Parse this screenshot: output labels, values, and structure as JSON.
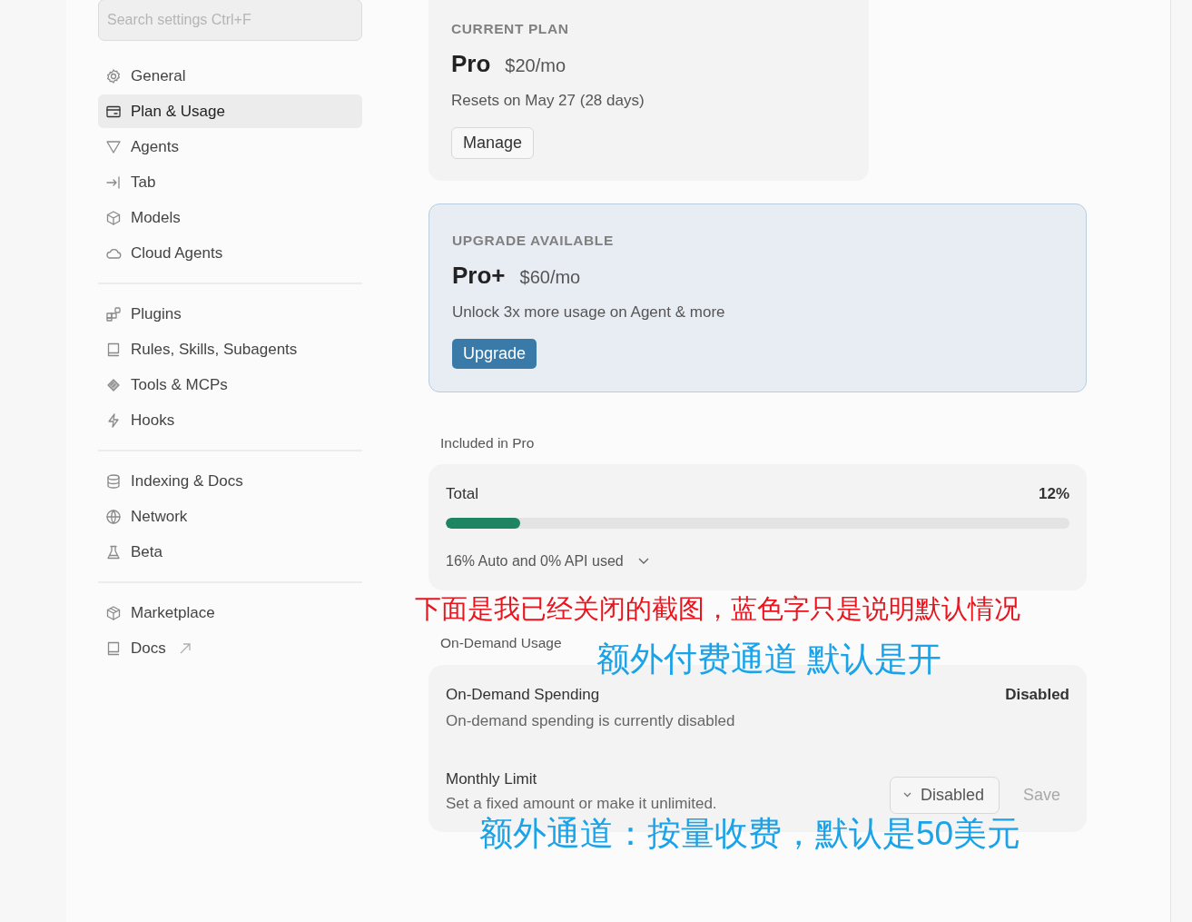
{
  "search": {
    "placeholder": "Search settings Ctrl+F"
  },
  "sidebar": {
    "groups": [
      {
        "items": [
          {
            "label": "General",
            "selected": false,
            "external": false
          },
          {
            "label": "Plan & Usage",
            "selected": true,
            "external": false
          },
          {
            "label": "Agents",
            "selected": false,
            "external": false
          },
          {
            "label": "Tab",
            "selected": false,
            "external": false
          },
          {
            "label": "Models",
            "selected": false,
            "external": false
          },
          {
            "label": "Cloud Agents",
            "selected": false,
            "external": false
          }
        ]
      },
      {
        "items": [
          {
            "label": "Plugins",
            "selected": false,
            "external": false
          },
          {
            "label": "Rules, Skills, Subagents",
            "selected": false,
            "external": false
          },
          {
            "label": "Tools & MCPs",
            "selected": false,
            "external": false
          },
          {
            "label": "Hooks",
            "selected": false,
            "external": false
          }
        ]
      },
      {
        "items": [
          {
            "label": "Indexing & Docs",
            "selected": false,
            "external": false
          },
          {
            "label": "Network",
            "selected": false,
            "external": false
          },
          {
            "label": "Beta",
            "selected": false,
            "external": false
          }
        ]
      },
      {
        "items": [
          {
            "label": "Marketplace",
            "selected": false,
            "external": false
          },
          {
            "label": "Docs",
            "selected": false,
            "external": true
          }
        ]
      }
    ]
  },
  "current_plan": {
    "heading": "CURRENT PLAN",
    "name": "Pro",
    "price": "$20/mo",
    "note": "Resets on May 27 (28 days)",
    "button": "Manage"
  },
  "upgrade": {
    "heading": "UPGRADE AVAILABLE",
    "name": "Pro+",
    "price": "$60/mo",
    "note": "Unlock 3x more usage on Agent & more",
    "button": "Upgrade"
  },
  "included": {
    "section": "Included in Pro",
    "label": "Total",
    "reading": "12%",
    "level": 0.12,
    "detail": "16% Auto and 0% API used",
    "expanded": false
  },
  "on_demand": {
    "section": "On-Demand Usage",
    "spending_title": "On-Demand Spending",
    "spending_note": "On-demand spending is currently disabled",
    "spending_status": "Disabled",
    "limit_title": "Monthly Limit",
    "limit_note": "Set a fixed amount or make it unlimited.",
    "limit_value": "Disabled",
    "save": {
      "label": "Save",
      "disabled": true
    }
  },
  "annotations": [
    {
      "text": "下面是我已经关闭的截图，蓝色字只是说明默认情况",
      "color": "#e8151f"
    },
    {
      "text": "额外付费通道  默认是开",
      "color": "#1aa3e8"
    },
    {
      "text": "额外通道：按量收费，默认是50美元",
      "color": "#1aa3e8"
    }
  ]
}
